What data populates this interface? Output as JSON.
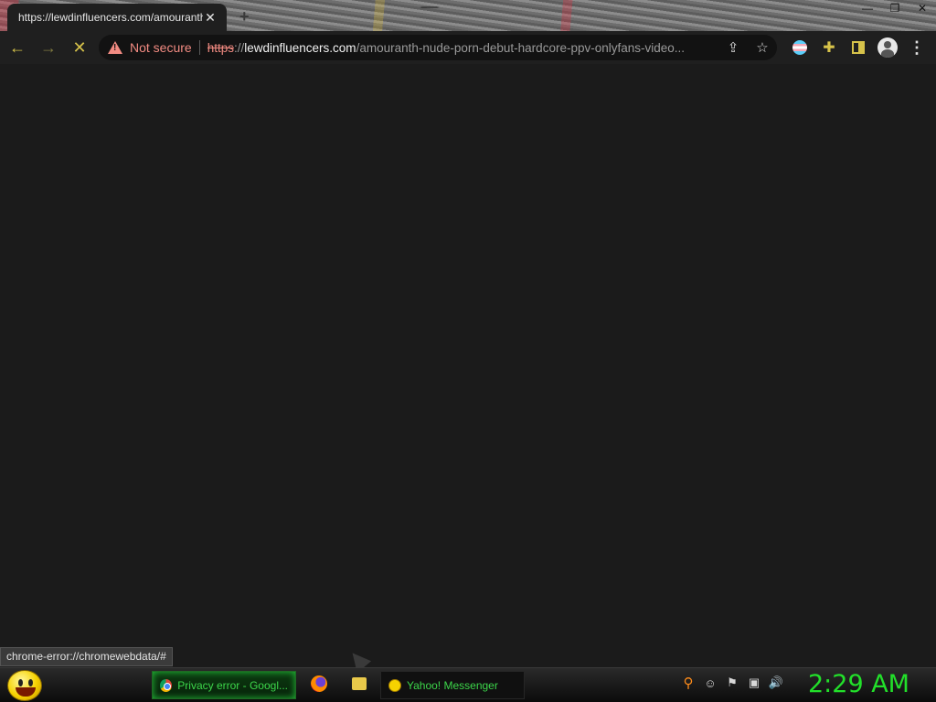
{
  "browser": {
    "tab": {
      "title": "https://lewdinfluencers.com/amouranth-nude-porn-debut-hardcore-ppv-onlyfans-video/"
    },
    "new_tab_symbol": "+",
    "window_controls": {
      "minimize": "—",
      "restore": "❐",
      "close": "✕"
    },
    "toolbar": {
      "back": "←",
      "forward": "→",
      "stop": "✕"
    },
    "omnibox": {
      "security_label": "Not secure",
      "url_scheme": "https",
      "url_slashes": "://",
      "url_host": "lewdinfluencers.com",
      "url_path": "/amouranth-nude-porn-debut-hardcore-ppv-onlyfans-video..."
    },
    "status_bar": "chrome-error://chromewebdata/#"
  },
  "taskbar": {
    "items": [
      {
        "label": "Privacy error - Googl...",
        "icon": "chrome-icon",
        "active": true
      },
      {
        "label": "",
        "icon": "firefox-icon",
        "active": false
      },
      {
        "label": "",
        "icon": "folder-icon",
        "active": false
      },
      {
        "label": "Yahoo! Messenger",
        "icon": "yahoo-messenger-icon",
        "active": false
      }
    ],
    "tray_icons": [
      "search-icon",
      "messenger-status-icon",
      "flag-icon",
      "network-icon",
      "volume-icon"
    ],
    "clock": "2:29 AM"
  },
  "colors": {
    "accent": "#d6c24a",
    "warning": "#f28b82",
    "taskbar_text": "#3cd64a",
    "clock": "#22e02a",
    "content_bg": "#1b1b1b"
  }
}
